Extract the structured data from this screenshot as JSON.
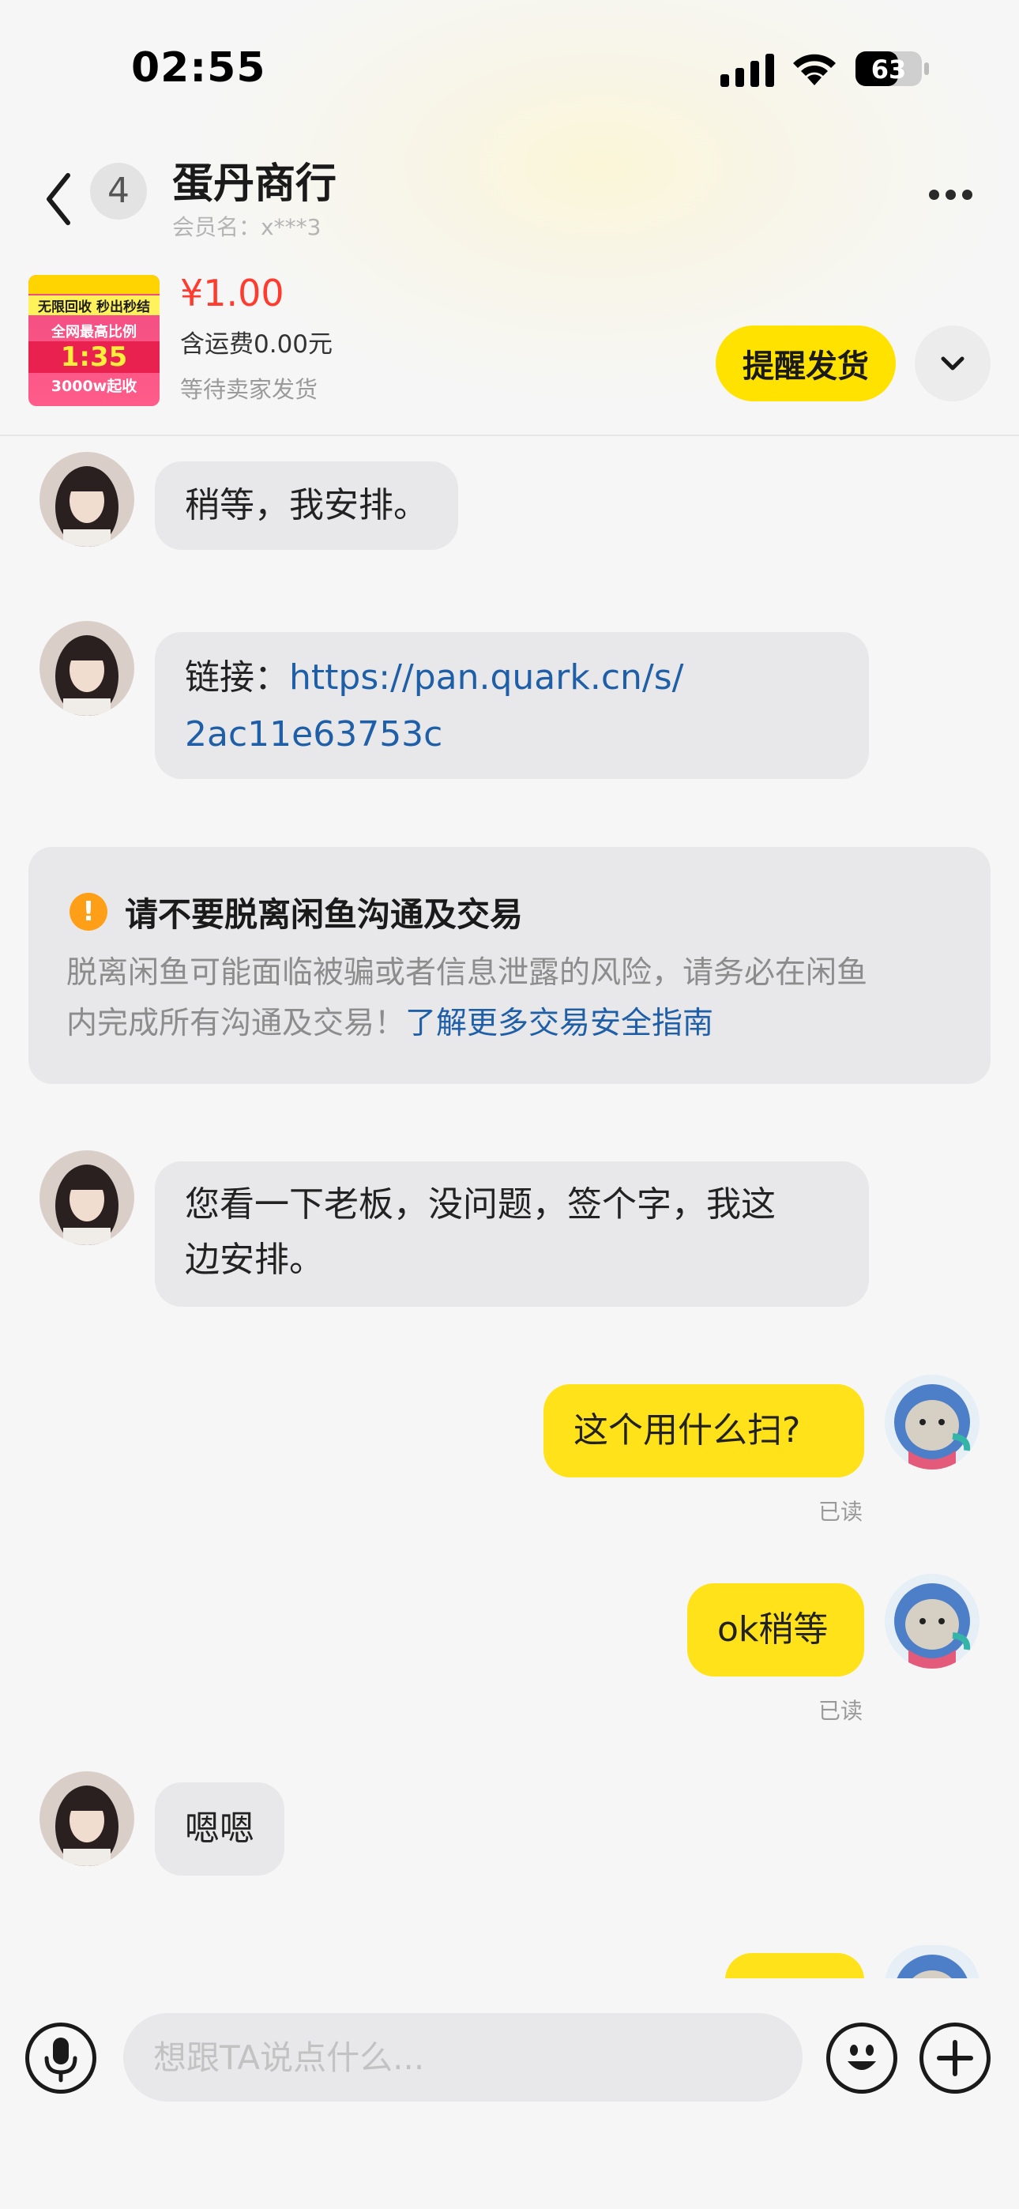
{
  "status_bar": {
    "time": "02:55",
    "battery": "63"
  },
  "header": {
    "unread_count": "4",
    "shop_name": "蛋丹商行",
    "member_name": "会员名：x***3"
  },
  "product": {
    "price": "¥1.00",
    "shipping": "含运费0.00元",
    "status": "等待卖家发货",
    "remind_label": "提醒发货",
    "thumb_lines": [
      "无限回收 秒出秒结",
      "全网最高比例",
      "1:35",
      "3000w起收"
    ]
  },
  "messages": [
    {
      "side": "left",
      "text": "稍等，我安排。"
    },
    {
      "side": "left",
      "prefix": "链接：",
      "link_line1": "https://pan.quark.cn/s/",
      "link_line2": "2ac11e63753c"
    },
    {
      "side": "left",
      "line1": "您看一下老板，没问题，签个字，我这",
      "line2": "边安排。"
    },
    {
      "side": "right",
      "text": "这个用什么扫?",
      "read": "已读"
    },
    {
      "side": "right",
      "text": "ok稍等",
      "read": "已读"
    },
    {
      "side": "left",
      "text": "嗯嗯"
    }
  ],
  "warning": {
    "title": "请不要脱离闲鱼沟通及交易",
    "body_line1": "脱离闲鱼可能面临被骗或者信息泄露的风险，请务必在闲鱼",
    "body_line2": "内完成所有沟通及交易！",
    "link": "了解更多交易安全指南"
  },
  "input": {
    "placeholder": "想跟TA说点什么..."
  },
  "colors": {
    "accent": "#ffe200",
    "price": "#ff3b30",
    "link": "#1e5fa8"
  }
}
